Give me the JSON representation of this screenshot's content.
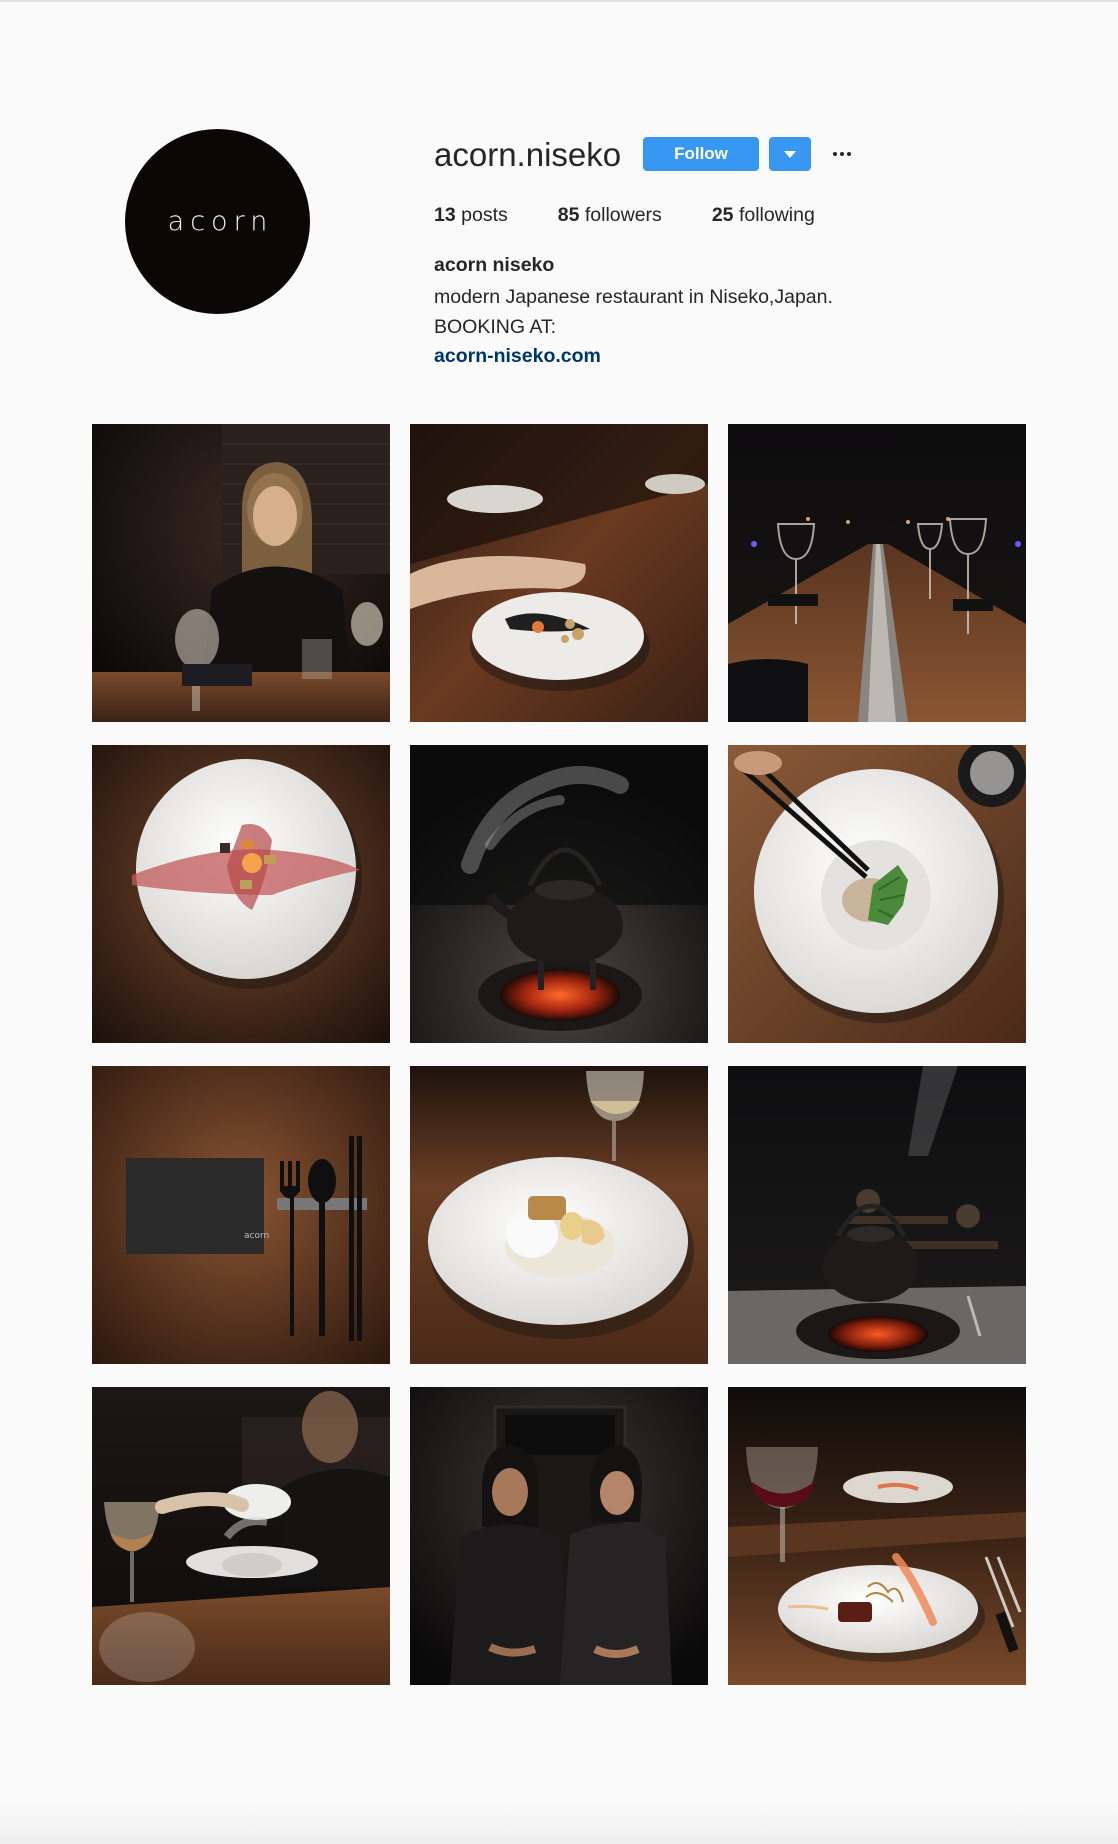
{
  "profile": {
    "avatar_text": "acorn",
    "username": "acorn.niseko",
    "follow_label": "Follow",
    "stats": {
      "posts_count": "13",
      "posts_label": "posts",
      "followers_count": "85",
      "followers_label": "followers",
      "following_count": "25",
      "following_label": "following"
    },
    "full_name": "acorn niseko",
    "bio_line1": "modern Japanese restaurant in Niseko,Japan.",
    "bio_line2": "BOOKING AT:",
    "website": "acorn-niseko.com"
  },
  "posts": [
    {
      "subject": "woman seated at dimly lit bar with wine glass"
    },
    {
      "subject": "hand presenting white plate with dish on wooden counter"
    },
    {
      "subject": "long counter with wine glasses and central fire trough"
    },
    {
      "subject": "overhead white plate with red powder streak and egg yolk"
    },
    {
      "subject": "iron kettle steaming over charcoal fire pit"
    },
    {
      "subject": "chopsticks placing green leaf on white plate"
    },
    {
      "subject": "table setting with menu card, fork, spoon and chopsticks"
    },
    {
      "subject": "white plate with dessert and glass of wine"
    },
    {
      "subject": "iron kettle on charcoal pit in dark dining room"
    },
    {
      "subject": "server lifting lid off bowl with smoke"
    },
    {
      "subject": "two chefs standing in doorway"
    },
    {
      "subject": "plated meat dish with red wine on counter"
    }
  ],
  "menu_card_text": "acorn",
  "colors": {
    "follow_blue": "#3897f0",
    "link_blue": "#003569",
    "background": "#fafafa",
    "text": "#262626",
    "avatar_bg": "#0b0707"
  },
  "icons": {
    "dropdown": "caret-down-icon",
    "more": "more-options-icon"
  }
}
